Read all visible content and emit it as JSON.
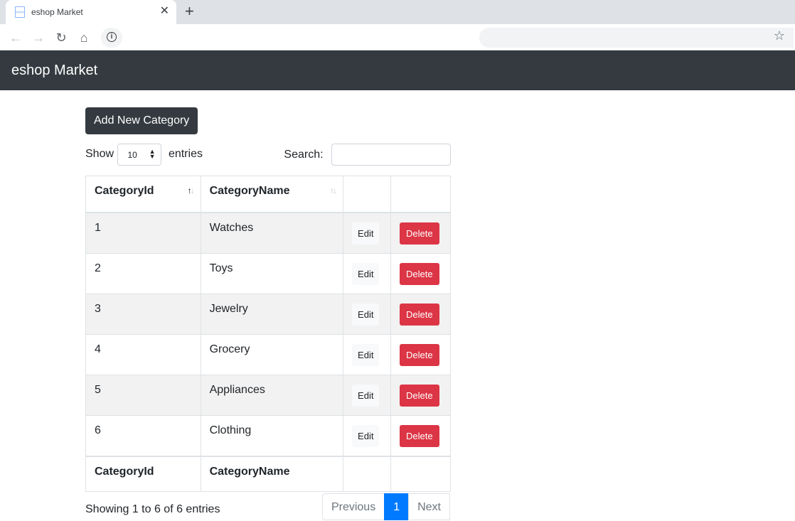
{
  "browser": {
    "tab_title": "eshop Market",
    "tab_close": "✕",
    "new_tab": "+"
  },
  "navbar": {
    "brand": "eshop Market"
  },
  "toolbar": {
    "add_label": "Add New Category"
  },
  "length": {
    "prefix": "Show",
    "value": "10",
    "suffix": "entries"
  },
  "search": {
    "label": "Search:",
    "value": ""
  },
  "table": {
    "headers": [
      "CategoryId",
      "CategoryName",
      "",
      ""
    ],
    "footers": [
      "CategoryId",
      "CategoryName",
      "",
      ""
    ],
    "rows": [
      {
        "id": "1",
        "name": "Watches",
        "edit": "Edit",
        "delete": "Delete"
      },
      {
        "id": "2",
        "name": "Toys",
        "edit": "Edit",
        "delete": "Delete"
      },
      {
        "id": "3",
        "name": "Jewelry",
        "edit": "Edit",
        "delete": "Delete"
      },
      {
        "id": "4",
        "name": "Grocery",
        "edit": "Edit",
        "delete": "Delete"
      },
      {
        "id": "5",
        "name": "Appliances",
        "edit": "Edit",
        "delete": "Delete"
      },
      {
        "id": "6",
        "name": "Clothing",
        "edit": "Edit",
        "delete": "Delete"
      }
    ]
  },
  "footer": {
    "info": "Showing 1 to 6 of 6 entries"
  },
  "pagination": {
    "previous": "Previous",
    "current": "1",
    "next": "Next"
  },
  "colors": {
    "navbar": "#343a40",
    "danger": "#dc3545",
    "primary": "#007bff"
  }
}
